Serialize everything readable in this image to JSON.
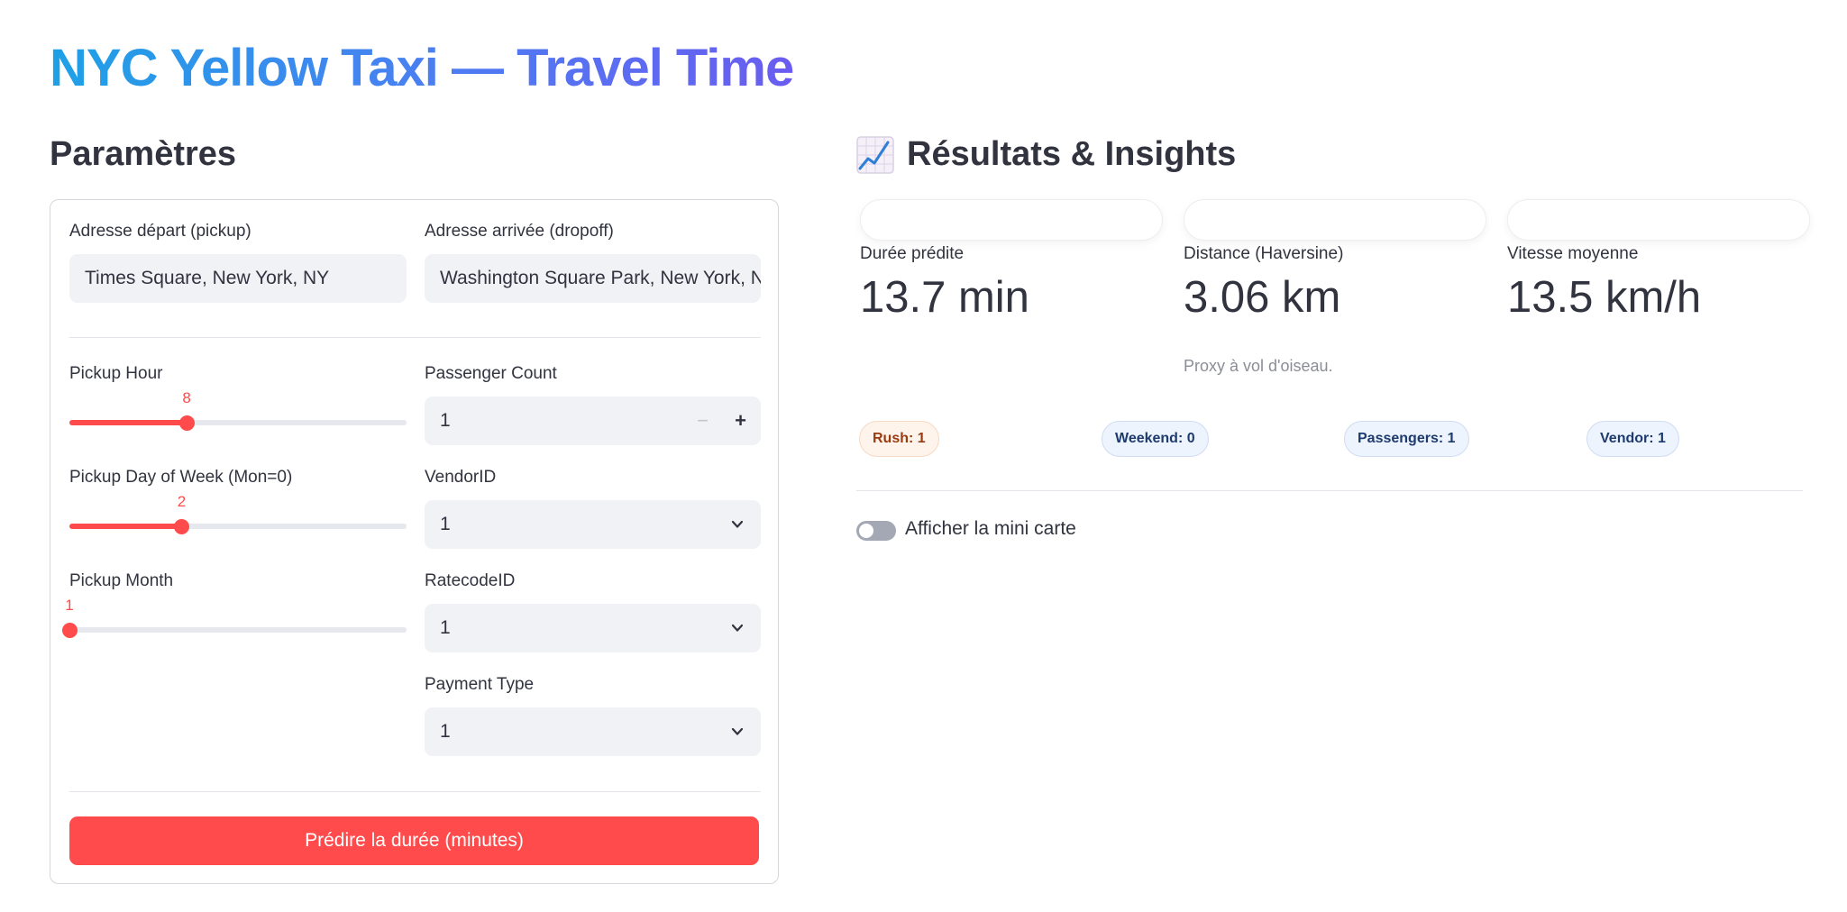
{
  "app": {
    "title": "NYC Yellow Taxi — Travel Time"
  },
  "params": {
    "title": "Paramètres",
    "pickup_address": {
      "label": "Adresse départ (pickup)",
      "value": "Times Square, New York, NY"
    },
    "dropoff_address": {
      "label": "Adresse arrivée (dropoff)",
      "value": "Washington Square Park, New York, NY"
    },
    "pickup_hour": {
      "label": "Pickup Hour",
      "value": "8",
      "fraction": 0.348
    },
    "pickup_day": {
      "label": "Pickup Day of Week (Mon=0)",
      "value": "2",
      "fraction": 0.333
    },
    "pickup_month": {
      "label": "Pickup Month",
      "value": "1",
      "fraction": 0.0
    },
    "passenger_count": {
      "label": "Passenger Count",
      "value": "1",
      "minus": "−",
      "plus": "+"
    },
    "vendor_id": {
      "label": "VendorID",
      "value": "1"
    },
    "ratecode_id": {
      "label": "RatecodeID",
      "value": "1"
    },
    "payment_type": {
      "label": "Payment Type",
      "value": "1"
    },
    "predict_button": "Prédire la durée (minutes)"
  },
  "results": {
    "title": "Résultats & Insights",
    "title_icon": "chart-increasing-icon",
    "metrics": [
      {
        "label": "Durée prédite",
        "value": "13.7 min"
      },
      {
        "label": "Distance (Haversine)",
        "value": "3.06 km",
        "caption": "Proxy à vol d'oiseau."
      },
      {
        "label": "Vitesse moyenne",
        "value": "13.5 km/h"
      }
    ],
    "badges": [
      {
        "text": "Rush: 1"
      },
      {
        "text": "Weekend: 0"
      },
      {
        "text": "Passengers: 1"
      },
      {
        "text": "Vendor: 1"
      }
    ],
    "map_toggle": {
      "label": "Afficher la mini carte",
      "on": false
    }
  },
  "colors": {
    "accent": "#ff4b4b",
    "title_gradient_start": "#1ea1e6",
    "title_gradient_end": "#6a5cf0"
  }
}
